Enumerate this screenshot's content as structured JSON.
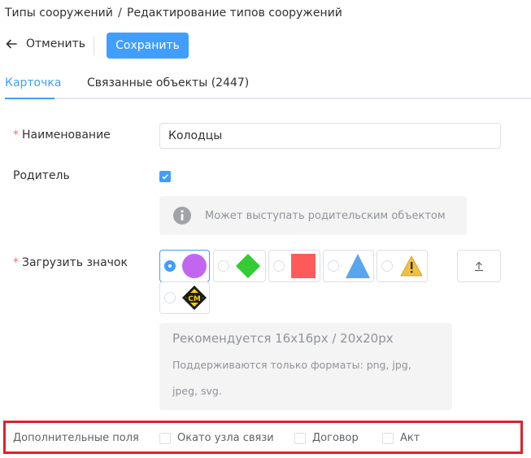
{
  "breadcrumb": {
    "parent": "Типы сооружений",
    "separator": "/",
    "current": "Редактирование типов сооружений"
  },
  "toolbar": {
    "cancel_label": "Отменить",
    "save_label": "Сохранить"
  },
  "tabs": [
    {
      "label": "Карточка",
      "active": true
    },
    {
      "label": "Связанные объекты (2447)",
      "active": false
    }
  ],
  "form": {
    "name": {
      "required_mark": "*",
      "label": "Наименование",
      "value": "Колодцы"
    },
    "parent": {
      "label": "Родитель",
      "checked": true,
      "info": "Может выступать родительским объектом"
    },
    "icon": {
      "required_mark": "*",
      "label": "Загрузить значок",
      "options": [
        {
          "name": "purple-circle-icon",
          "color": "#c266f0",
          "selected": true
        },
        {
          "name": "green-diamond-icon",
          "color": "#33cc33",
          "selected": false
        },
        {
          "name": "red-square-icon",
          "color": "#ff5a5a",
          "selected": false
        },
        {
          "name": "blue-triangle-icon",
          "color": "#5aa6ee",
          "selected": false
        },
        {
          "name": "warning-triangle-icon",
          "color": "#f0c040",
          "selected": false
        },
        {
          "name": "cm-sign-icon",
          "color": "#f5d000",
          "selected": false,
          "text": "CM"
        }
      ],
      "upload_icon": "upload-icon",
      "hint_title": "Рекомендуется 16x16px / 20x20px",
      "hint_text": "Поддерживаются только форматы: png, jpg, jpeg, svg."
    }
  },
  "extra_fields": {
    "label": "Дополнительные поля",
    "options": [
      {
        "label": "Окато узла связи",
        "checked": false
      },
      {
        "label": "Договор",
        "checked": false
      },
      {
        "label": "Акт",
        "checked": false
      }
    ]
  },
  "colors": {
    "accent": "#409eff",
    "required": "#f56c6c",
    "highlight_frame": "#e0202a"
  }
}
